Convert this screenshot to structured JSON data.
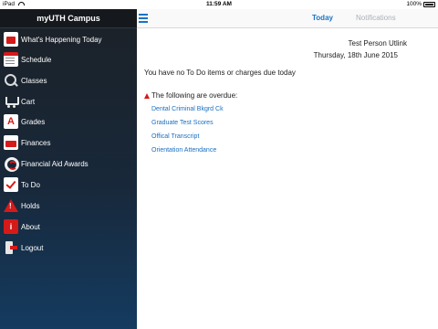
{
  "status_bar": {
    "device": "iPad",
    "time": "11:59 AM",
    "battery": "100%"
  },
  "sidebar": {
    "title": "myUTH Campus",
    "items": [
      {
        "label": "What's Happening Today",
        "icon": "megaphone-icon"
      },
      {
        "label": "Schedule",
        "icon": "calendar-icon"
      },
      {
        "label": "Classes",
        "icon": "magnifier-icon"
      },
      {
        "label": "Cart",
        "icon": "cart-icon"
      },
      {
        "label": "Grades",
        "icon": "grade-a-icon"
      },
      {
        "label": "Finances",
        "icon": "wallet-icon"
      },
      {
        "label": "Financial Aid Awards",
        "icon": "lifebuoy-icon"
      },
      {
        "label": "To Do",
        "icon": "checkmark-icon"
      },
      {
        "label": "Holds",
        "icon": "warning-icon"
      },
      {
        "label": "About",
        "icon": "info-icon"
      },
      {
        "label": "Logout",
        "icon": "logout-icon"
      }
    ]
  },
  "topbar": {
    "menu_icon": "hamburger-icon",
    "tabs": [
      {
        "label": "Today",
        "active": true
      },
      {
        "label": "Notifications",
        "active": false
      }
    ]
  },
  "main": {
    "person_name": "Test Person Utlink",
    "date": "Thursday, 18th June 2015",
    "no_todo_text": "You have no To Do items or charges due today",
    "overdue_heading": "The following are overdue:",
    "overdue_items": [
      "Dental Criminal Bkgrd Ck",
      "Graduate Test Scores",
      "Offical Transcript",
      "Orientation Attendance"
    ]
  },
  "colors": {
    "accent": "#1a73c6",
    "alert": "#d51a1a",
    "sidebar_top": "#1c2127",
    "sidebar_bottom": "#143b60"
  }
}
